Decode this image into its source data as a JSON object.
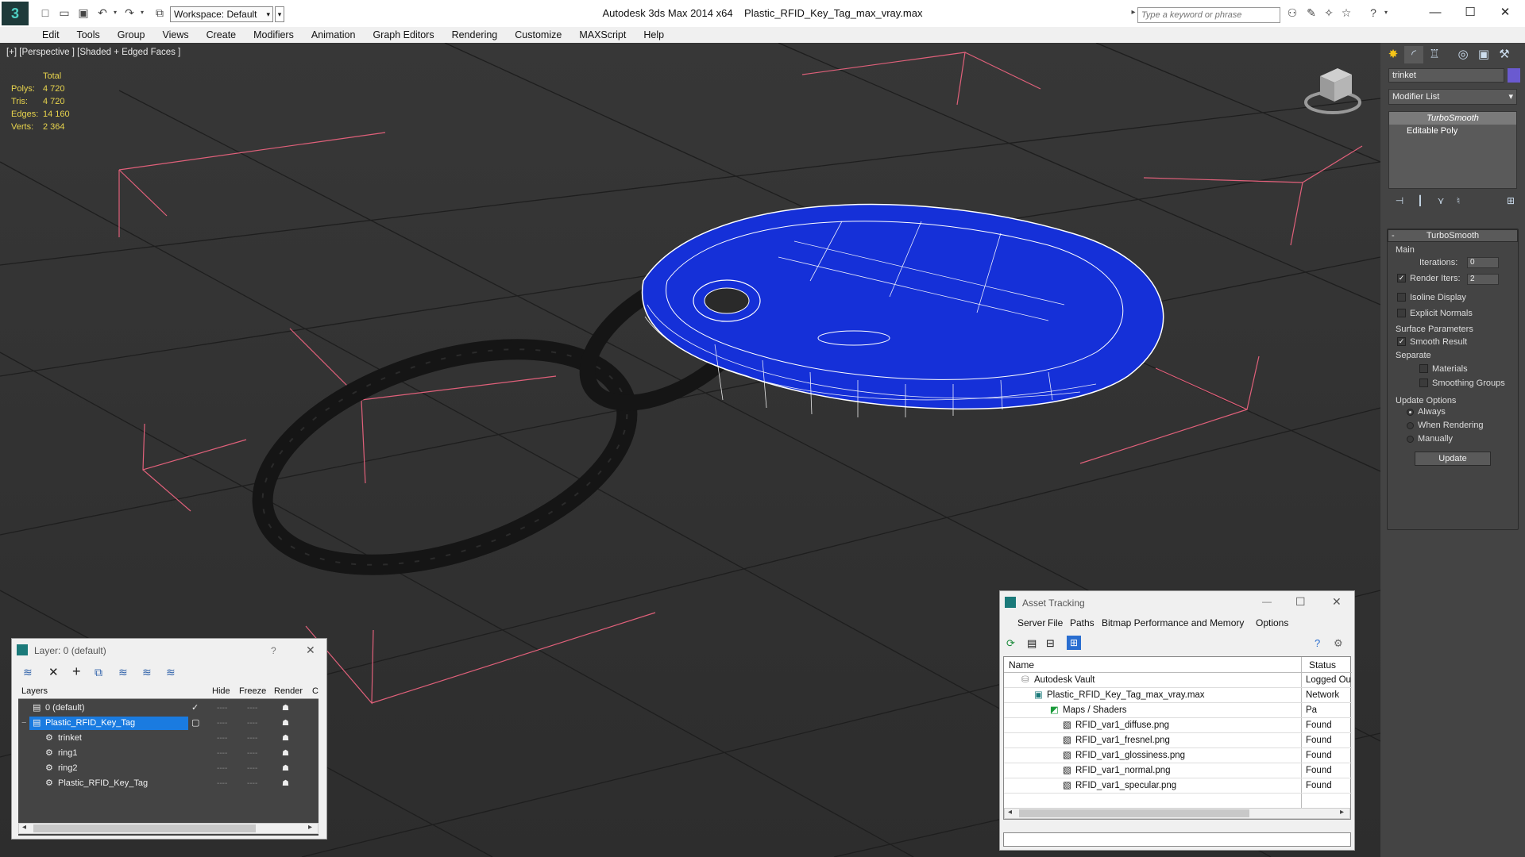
{
  "app": {
    "title": "Autodesk 3ds Max  2014 x64",
    "file": "Plastic_RFID_Key_Tag_max_vray.max",
    "workspace": "Workspace: Default",
    "search_placeholder": "Type a keyword or phrase"
  },
  "menu": [
    "Edit",
    "Tools",
    "Group",
    "Views",
    "Create",
    "Modifiers",
    "Animation",
    "Graph Editors",
    "Rendering",
    "Customize",
    "MAXScript",
    "Help"
  ],
  "viewport": {
    "label": "[+] [Perspective ] [Shaded + Edged Faces ]",
    "stats": {
      "header": "Total",
      "rows": [
        {
          "k": "Polys:",
          "v": "4 720"
        },
        {
          "k": "Tris:",
          "v": "4 720"
        },
        {
          "k": "Edges:",
          "v": "14 160"
        },
        {
          "k": "Verts:",
          "v": "2 364"
        }
      ]
    }
  },
  "command_panel": {
    "object_name": "trinket",
    "modifier_list": "Modifier List",
    "stack": [
      "TurboSmooth",
      "Editable Poly"
    ],
    "rollout_title": "TurboSmooth",
    "main_label": "Main",
    "iterations_label": "Iterations:",
    "iterations_value": "0",
    "render_iters_label": "Render Iters:",
    "render_iters_value": "2",
    "isoline": "Isoline Display",
    "explicit_normals": "Explicit Normals",
    "surface_params": "Surface Parameters",
    "smooth_result": "Smooth Result",
    "separate": "Separate",
    "materials": "Materials",
    "smoothing_groups": "Smoothing Groups",
    "update_options": "Update Options",
    "always": "Always",
    "when_rendering": "When Rendering",
    "manually": "Manually",
    "update_button": "Update"
  },
  "layer_dialog": {
    "title": "Layer: 0 (default)",
    "help": "?",
    "columns": [
      "Layers",
      "Hide",
      "Freeze",
      "Render",
      "C"
    ],
    "rows": [
      {
        "name": "0 (default)",
        "indent": 0
      },
      {
        "name": "Plastic_RFID_Key_Tag",
        "indent": 0,
        "selected": true
      },
      {
        "name": "trinket",
        "indent": 1
      },
      {
        "name": "ring1",
        "indent": 1
      },
      {
        "name": "ring2",
        "indent": 1
      },
      {
        "name": "Plastic_RFID_Key_Tag",
        "indent": 1
      }
    ],
    "dash": "----"
  },
  "asset_tracking": {
    "title": "Asset Tracking",
    "menu": [
      "Server",
      "File",
      "Paths",
      "Bitmap Performance and Memory",
      "Options"
    ],
    "col_name": "Name",
    "col_status": "Status",
    "rows": [
      {
        "name": "Autodesk Vault",
        "status": "Logged Ou",
        "indent": 0
      },
      {
        "name": "Plastic_RFID_Key_Tag_max_vray.max",
        "status": "Network Pa",
        "indent": 1
      },
      {
        "name": "Maps / Shaders",
        "status": "",
        "indent": 2
      },
      {
        "name": "RFID_var1_diffuse.png",
        "status": "Found",
        "indent": 3
      },
      {
        "name": "RFID_var1_fresnel.png",
        "status": "Found",
        "indent": 3
      },
      {
        "name": "RFID_var1_glossiness.png",
        "status": "Found",
        "indent": 3
      },
      {
        "name": "RFID_var1_normal.png",
        "status": "Found",
        "indent": 3
      },
      {
        "name": "RFID_var1_specular.png",
        "status": "Found",
        "indent": 3
      }
    ]
  }
}
